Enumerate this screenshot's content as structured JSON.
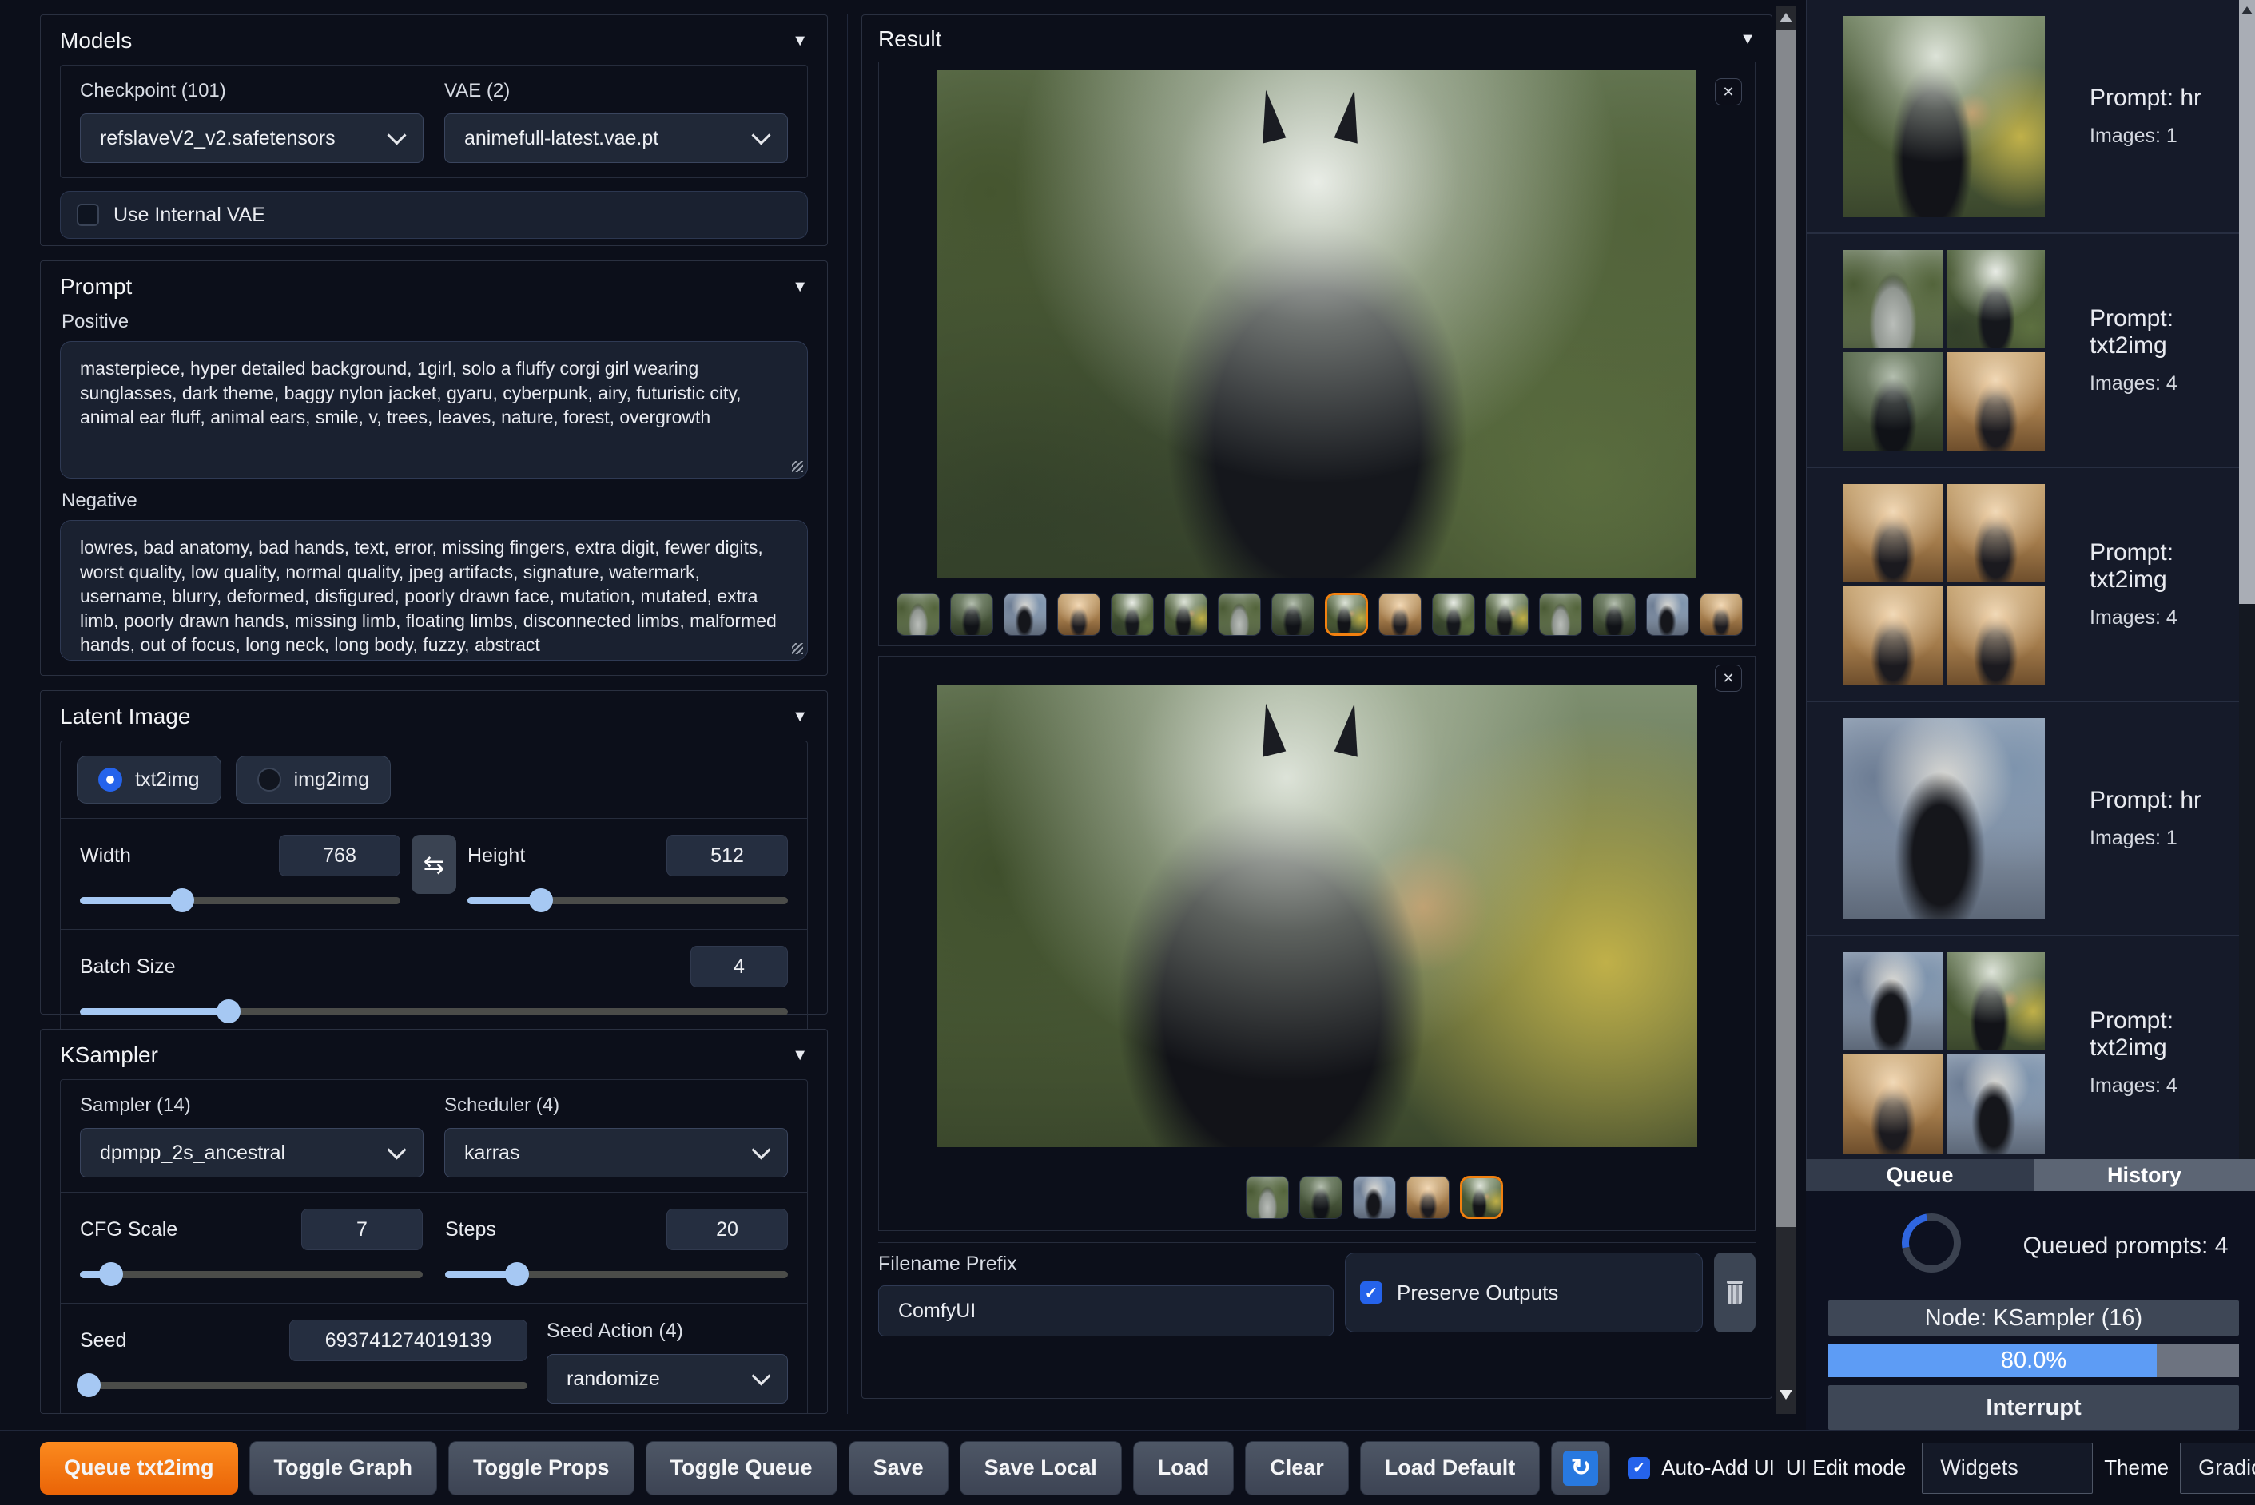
{
  "icons": {
    "collapse": "▼",
    "close": "✕",
    "swap": "⇆",
    "check": "✓",
    "refresh": "↻"
  },
  "models": {
    "title": "Models",
    "checkpoint_label": "Checkpoint (101)",
    "checkpoint_value": "refslaveV2_v2.safetensors",
    "vae_label": "VAE (2)",
    "vae_value": "animefull-latest.vae.pt",
    "internal_vae_label": "Use Internal VAE"
  },
  "prompt": {
    "title": "Prompt",
    "positive_label": "Positive",
    "positive_value": "masterpiece, hyper detailed background, 1girl, solo a fluffy corgi girl wearing sunglasses, dark theme, baggy nylon jacket, gyaru, cyberpunk, airy, futuristic city, animal ear fluff, animal ears, smile, v, trees, leaves, nature, forest, overgrowth",
    "negative_label": "Negative",
    "negative_value": "lowres, bad anatomy, bad hands, text, error, missing fingers, extra digit, fewer digits, worst quality, low quality, normal quality, jpeg artifacts, signature, watermark, username, blurry, deformed, disfigured, poorly drawn face, mutation, mutated, extra limb, poorly drawn hands, missing limb, floating limbs, disconnected limbs, malformed hands, out of focus, long neck, long body, fuzzy, abstract"
  },
  "latent": {
    "title": "Latent Image",
    "txt2img": "txt2img",
    "img2img": "img2img",
    "width_label": "Width",
    "width_value": "768",
    "height_label": "Height",
    "height_value": "512",
    "batch_label": "Batch Size",
    "batch_value": "4"
  },
  "ksampler": {
    "title": "KSampler",
    "sampler_label": "Sampler (14)",
    "sampler_value": "dpmpp_2s_ancestral",
    "scheduler_label": "Scheduler (4)",
    "scheduler_value": "karras",
    "cfg_label": "CFG Scale",
    "cfg_value": "7",
    "steps_label": "Steps",
    "steps_value": "20",
    "seed_label": "Seed",
    "seed_value": "693741274019139",
    "seed_action_label": "Seed Action (4)",
    "seed_action_value": "randomize"
  },
  "result": {
    "title": "Result",
    "filename_label": "Filename Prefix",
    "filename_value": "ComfyUI",
    "preserve_label": "Preserve Outputs",
    "gallery1": {
      "count": 17,
      "selected": 8
    },
    "gallery2": {
      "count": 5,
      "selected": 4
    }
  },
  "sidebar": {
    "entries": [
      {
        "prompt": "Prompt: hr",
        "images": "Images: 1",
        "layout": "single"
      },
      {
        "prompt": "Prompt: txt2img",
        "images": "Images: 4",
        "layout": "grid"
      },
      {
        "prompt": "Prompt: txt2img",
        "images": "Images: 4",
        "layout": "grid"
      },
      {
        "prompt": "Prompt: hr",
        "images": "Images: 1",
        "layout": "single"
      },
      {
        "prompt": "Prompt: txt2img",
        "images": "Images: 4",
        "layout": "grid"
      }
    ],
    "queue_tab": "Queue",
    "history_tab": "History",
    "queued": "Queued prompts: 4",
    "node": "Node: KSampler (16)",
    "progress_label": "80.0%",
    "progress_pct": 80,
    "interrupt": "Interrupt"
  },
  "bottom": {
    "queue_button": "Queue txt2img",
    "buttons": [
      "Toggle Graph",
      "Toggle Props",
      "Toggle Queue",
      "Save",
      "Save Local",
      "Load",
      "Clear",
      "Load Default"
    ],
    "auto_add": "Auto-Add UI",
    "ui_edit": "UI Edit mode",
    "widgets": "Widgets",
    "theme_label": "Theme",
    "theme_value": "Gradio Dark"
  },
  "colors": {
    "accent_orange": "#f2800f",
    "accent_blue": "#2563eb",
    "progress_blue": "#5d9cf5"
  }
}
